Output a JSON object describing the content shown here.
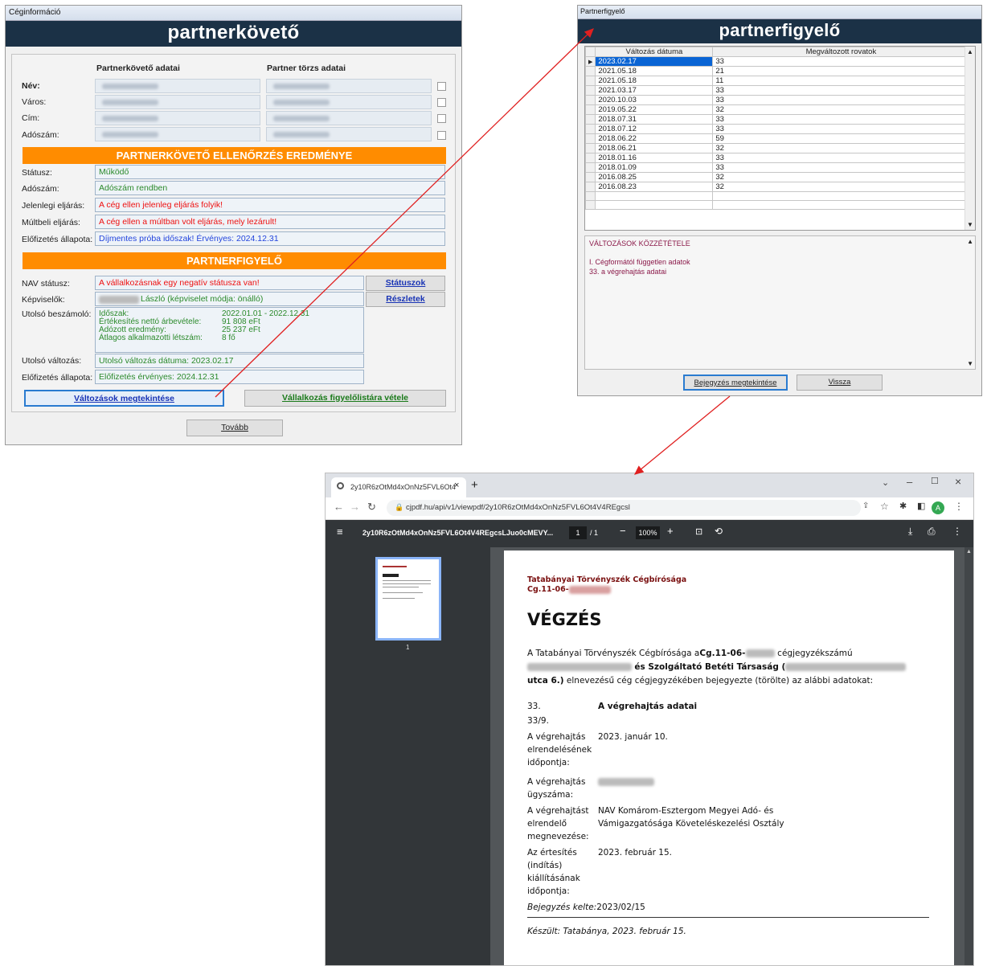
{
  "win1": {
    "title": "Céginformáció",
    "brand": "partnerkövető",
    "col_headers": [
      "Partnerkövető adatai",
      "Partner törzs adatai"
    ],
    "rows": [
      "Név:",
      "Város:",
      "Cím:",
      "Adószám:"
    ],
    "check_title": "PARTNERKÖVETŐ ELLENŐRZÉS EREDMÉNYE",
    "check_rows": [
      {
        "label": "Státusz:",
        "value": "Működő"
      },
      {
        "label": "Adószám:",
        "value": "Adószám rendben"
      },
      {
        "label": "Jelenlegi eljárás:",
        "value": "A cég ellen jelenleg eljárás folyik!"
      },
      {
        "label": "Múltbeli eljárás:",
        "value": "A cég ellen a múltban volt eljárás, mely lezárult!"
      },
      {
        "label": "Előfizetés állapota:",
        "value": "Díjmentes próba időszak! Érvényes: 2024.12.31"
      }
    ],
    "pf_title": "PARTNERFIGYELŐ",
    "nav_label": "NAV státusz:",
    "nav_value": "A vállalkozásnak egy negatív státusza van!",
    "statuszok_btn": "Státuszok",
    "kepv_label": "Képviselők:",
    "kepv_value": "László (képviselet módja: önálló)",
    "reszletek_btn": "Részletek",
    "besz_label": "Utolsó beszámoló:",
    "besz": [
      {
        "k": "Időszak:",
        "v": "2022.01.01 - 2022.12.31"
      },
      {
        "k": "Értékesítés nettó árbevétele:",
        "v": "91 808 eFt"
      },
      {
        "k": "Adózott eredmény:",
        "v": "25 237 eFt"
      },
      {
        "k": "Átlagos alkalmazotti létszám:",
        "v": "8 fő"
      }
    ],
    "valt_label": "Utolsó változás:",
    "valt_value": "Utolsó változás dátuma: 2023.02.17",
    "elof_label": "Előfizetés állapota:",
    "elof_value": "Előfizetés érvényes: 2024.12.31",
    "btn_valtozasok": "Változások megtekintése",
    "btn_figyelo": "Vállalkozás figyelőlistára vétele",
    "btn_tovabb": "Tovább"
  },
  "win2": {
    "title": "Partnerfigyelő",
    "brand": "partnerfigyelő",
    "col1": "Változás dátuma",
    "col2": "Megváltozott rovatok",
    "rows": [
      [
        "2023.02.17",
        "33"
      ],
      [
        "2021.05.18",
        "21"
      ],
      [
        "2021.05.18",
        "11"
      ],
      [
        "2021.03.17",
        "33"
      ],
      [
        "2020.10.03",
        "33"
      ],
      [
        "2019.05.22",
        "32"
      ],
      [
        "2018.07.31",
        "33"
      ],
      [
        "2018.07.12",
        "33"
      ],
      [
        "2018.06.22",
        "59"
      ],
      [
        "2018.06.21",
        "32"
      ],
      [
        "2018.01.16",
        "33"
      ],
      [
        "2018.01.09",
        "33"
      ],
      [
        "2016.08.25",
        "32"
      ],
      [
        "2016.08.23",
        "32"
      ]
    ],
    "section_title": "VÁLTOZÁSOK KÖZZÉTÉTELE",
    "section_lines": [
      "I.   Cégformától független adatok",
      "33. a végrehajtás adatai"
    ],
    "btn_bejegyzes": "Bejegyzés megtekintése",
    "btn_vissza": "Vissza"
  },
  "browser": {
    "tab_title": "2y10R6zOtMd4xOnNz5FVL6Ot4",
    "url": "cjpdf.hu/api/v1/viewpdf/2y10R6zOtMd4xOnNz5FVL6Ot4V4REgcsl",
    "avatar": "A",
    "pdf_title": "2y10R6zOtMd4xOnNz5FVL6Ot4V4REgcsLJuo0cMEVY...",
    "page": "1",
    "pages": "/ 1",
    "zoom": "100%",
    "thumb_num": "1",
    "court": "Tatabányai Törvényszék Cégbírósága",
    "cg": "Cg.11-06-",
    "heading": "VÉGZÉS",
    "intro1": "A Tatabányai Törvényszék Cégbírósága a",
    "intro_cg": "Cg.11-06-",
    "intro2": "cégjegyzékszámú",
    "intro3": "és Szolgáltató Betéti Társaság (",
    "intro4": "utca 6.)",
    "intro5": "elnevezésű cég cégjegyzékében bejegyezte (törölte) az alábbi adatokat:",
    "sec_num": "33.",
    "sec_title": "A végrehajtás adatai",
    "sub": "33/9.",
    "items": [
      {
        "k": "A végrehajtás elrendelésének időpontja:",
        "v": "2023. január 10."
      },
      {
        "k": "A végrehajtás ügyszáma:",
        "v": ""
      },
      {
        "k": "A végrehajtást elrendelő megnevezése:",
        "v": "NAV Komárom-Esztergom Megyei Adó- és Vámigazgatósága Követeléskezelési Osztály"
      },
      {
        "k": "Az értesítés (indítás) kiállításának időpontja:",
        "v": "2023. február 15."
      }
    ],
    "kelte_label": "Bejegyzés kelte:",
    "kelte_value": "2023/02/15",
    "keszult": "Készült: Tatabánya, 2023. február 15."
  },
  "colors": {
    "brand_bg": "#1b3146",
    "orange": "#ff8c00",
    "green": "#2b8a2b",
    "red": "#ee1111",
    "blue": "#2244dd",
    "arrow": "#e02020"
  }
}
